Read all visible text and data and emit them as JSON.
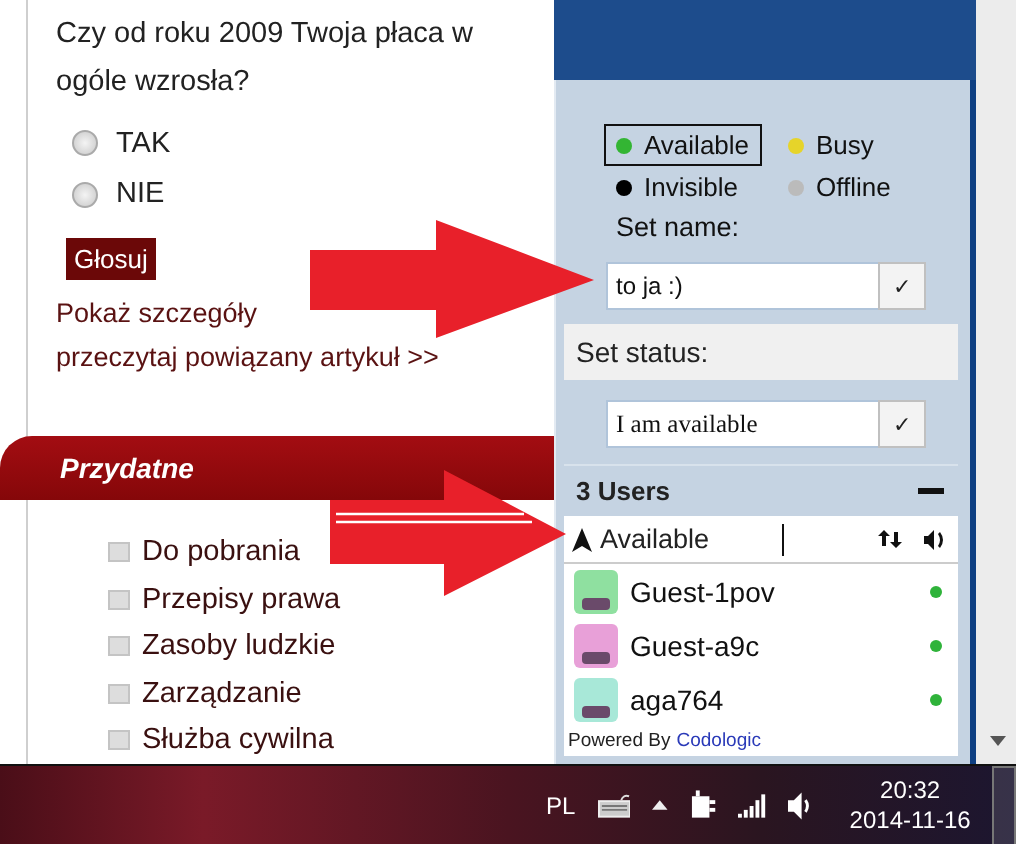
{
  "poll": {
    "question": "Czy od roku 2009 Twoja płaca w ogóle wzrosła?",
    "options": [
      {
        "label": "TAK",
        "selected": false
      },
      {
        "label": "NIE",
        "selected": false
      }
    ],
    "vote_button": "Głosuj",
    "links": [
      "Pokaż szczegóły",
      "przeczytaj powiązany artykuł >>"
    ]
  },
  "useful": {
    "title": "Przydatne",
    "items": [
      "Do pobrania",
      "Przepisy prawa",
      "Zasoby ludzkie",
      "Zarządzanie",
      "Służba cywilna"
    ]
  },
  "chat": {
    "statuses": [
      {
        "label": "Available",
        "color": "#33b533",
        "selected": true
      },
      {
        "label": "Busy",
        "color": "#e6d42a",
        "selected": false
      },
      {
        "label": "Invisible",
        "color": "#000000",
        "selected": false
      },
      {
        "label": "Offline",
        "color": "#bbbbbb",
        "selected": false
      }
    ],
    "set_name_label": "Set name:",
    "name_value": "to ja :)",
    "name_button": "✓",
    "set_status_label": "Set status:",
    "status_value": "I am available",
    "status_button": "✓",
    "users_count": "3 Users",
    "filter_label": "Available",
    "users": [
      {
        "name": "Guest-1pov",
        "online": true
      },
      {
        "name": "Guest-a9c",
        "online": true
      },
      {
        "name": "aga764",
        "online": true
      }
    ],
    "powered_by": "Powered By",
    "powered_link": "Codologic"
  },
  "taskbar": {
    "language": "PL",
    "time": "20:32",
    "date": "2014-11-16"
  }
}
